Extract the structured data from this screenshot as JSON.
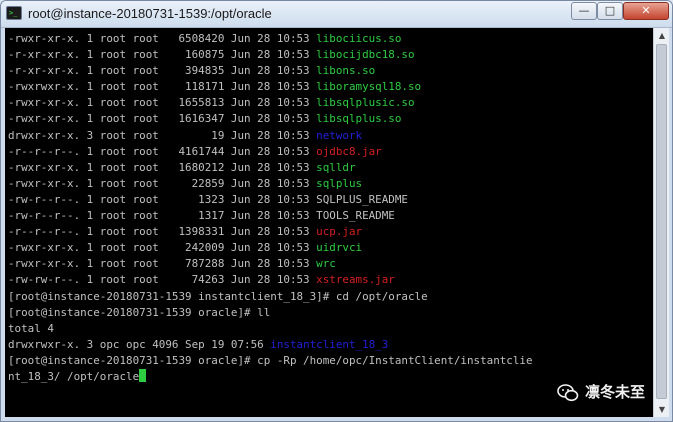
{
  "window": {
    "title": "root@instance-20180731-1539:/opt/oracle",
    "icon": "terminal-icon",
    "controls": {
      "minimize": "minimize-icon",
      "maximize": "maximize-icon",
      "close": "close-icon"
    }
  },
  "colors": {
    "green": "#2ecc40",
    "blue": "#2020d8",
    "red": "#d42020",
    "gray": "#c0c0c0"
  },
  "terminal": {
    "lines": [
      [
        {
          "t": "-rwxr-xr-x. 1 root root   6508420 Jun 28 10:53 "
        },
        {
          "t": "libociicus.so",
          "c": "green"
        }
      ],
      [
        {
          "t": "-r-xr-xr-x. 1 root root    160875 Jun 28 10:53 "
        },
        {
          "t": "libocijdbc18.so",
          "c": "green"
        }
      ],
      [
        {
          "t": "-r-xr-xr-x. 1 root root    394835 Jun 28 10:53 "
        },
        {
          "t": "libons.so",
          "c": "green"
        }
      ],
      [
        {
          "t": "-rwxrwxr-x. 1 root root    118171 Jun 28 10:53 "
        },
        {
          "t": "liboramysql18.so",
          "c": "green"
        }
      ],
      [
        {
          "t": "-rwxr-xr-x. 1 root root   1655813 Jun 28 10:53 "
        },
        {
          "t": "libsqlplusic.so",
          "c": "green"
        }
      ],
      [
        {
          "t": "-rwxr-xr-x. 1 root root   1616347 Jun 28 10:53 "
        },
        {
          "t": "libsqlplus.so",
          "c": "green"
        }
      ],
      [
        {
          "t": "drwxr-xr-x. 3 root root        19 Jun 28 10:53 "
        },
        {
          "t": "network",
          "c": "blue"
        }
      ],
      [
        {
          "t": "-r--r--r--. 1 root root   4161744 Jun 28 10:53 "
        },
        {
          "t": "ojdbc8.jar",
          "c": "red"
        }
      ],
      [
        {
          "t": "-rwxr-xr-x. 1 root root   1680212 Jun 28 10:53 "
        },
        {
          "t": "sqlldr",
          "c": "green"
        }
      ],
      [
        {
          "t": "-rwxr-xr-x. 1 root root     22859 Jun 28 10:53 "
        },
        {
          "t": "sqlplus",
          "c": "green"
        }
      ],
      [
        {
          "t": "-rw-r--r--. 1 root root      1323 Jun 28 10:53 SQLPLUS_README"
        }
      ],
      [
        {
          "t": "-rw-r--r--. 1 root root      1317 Jun 28 10:53 TOOLS_README"
        }
      ],
      [
        {
          "t": "-r--r--r--. 1 root root   1398331 Jun 28 10:53 "
        },
        {
          "t": "ucp.jar",
          "c": "red"
        }
      ],
      [
        {
          "t": "-rwxr-xr-x. 1 root root    242009 Jun 28 10:53 "
        },
        {
          "t": "uidrvci",
          "c": "green"
        }
      ],
      [
        {
          "t": "-rwxr-xr-x. 1 root root    787288 Jun 28 10:53 "
        },
        {
          "t": "wrc",
          "c": "green"
        }
      ],
      [
        {
          "t": "-rw-rw-r--. 1 root root     74263 Jun 28 10:53 "
        },
        {
          "t": "xstreams.jar",
          "c": "red"
        }
      ],
      [
        {
          "t": "[root@instance-20180731-1539 instantclient_18_3]# cd /opt/oracle"
        }
      ],
      [
        {
          "t": "[root@instance-20180731-1539 oracle]# ll"
        }
      ],
      [
        {
          "t": "total 4"
        }
      ],
      [
        {
          "t": "drwxrwxr-x. 3 opc opc 4096 Sep 19 07:56 "
        },
        {
          "t": "instantclient_18_3",
          "c": "blue"
        }
      ],
      [
        {
          "t": "[root@instance-20180731-1539 oracle]# cp -Rp /home/opc/InstantClient/instantclie"
        }
      ],
      [
        {
          "t": "nt_18_3/ /opt/oracle"
        }
      ]
    ],
    "cursor_color": "green"
  },
  "scrollbar": {
    "up": "arrow-up-icon",
    "down": "arrow-down-icon"
  },
  "watermark": {
    "text": "凛冬未至",
    "logo": "wechat-logo"
  }
}
